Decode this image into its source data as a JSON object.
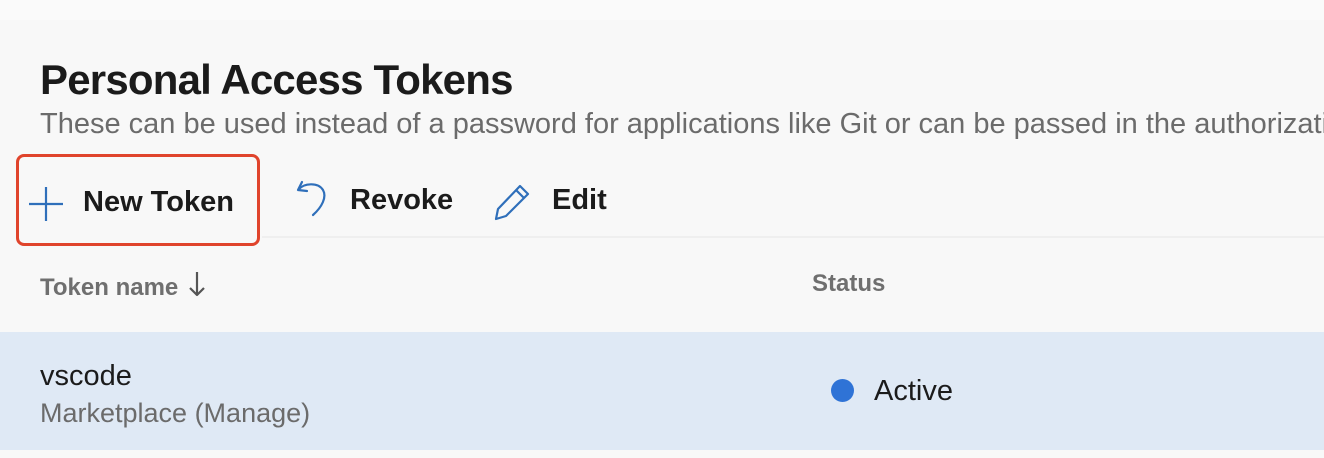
{
  "page": {
    "title": "Personal Access Tokens",
    "subtitle": "These can be used instead of a password for applications like Git or can be passed in the authorization header to access REST APIs"
  },
  "toolbar": {
    "new_token_label": "New Token",
    "new_token_icon": "plus-icon",
    "revoke_label": "Revoke",
    "revoke_icon": "undo-icon",
    "edit_label": "Edit",
    "edit_icon": "pencil-icon",
    "highlight_color": "#e0442c",
    "icon_color": "#2f6fba"
  },
  "table": {
    "columns": [
      {
        "label": "Token name",
        "sort": "descending",
        "sort_icon": "arrow-down-icon"
      },
      {
        "label": "Status"
      }
    ],
    "rows": [
      {
        "name": "vscode",
        "scope": "Marketplace (Manage)",
        "status": "Active",
        "status_color": "#2f73d6",
        "selected_background": "#dfe9f5"
      }
    ]
  }
}
